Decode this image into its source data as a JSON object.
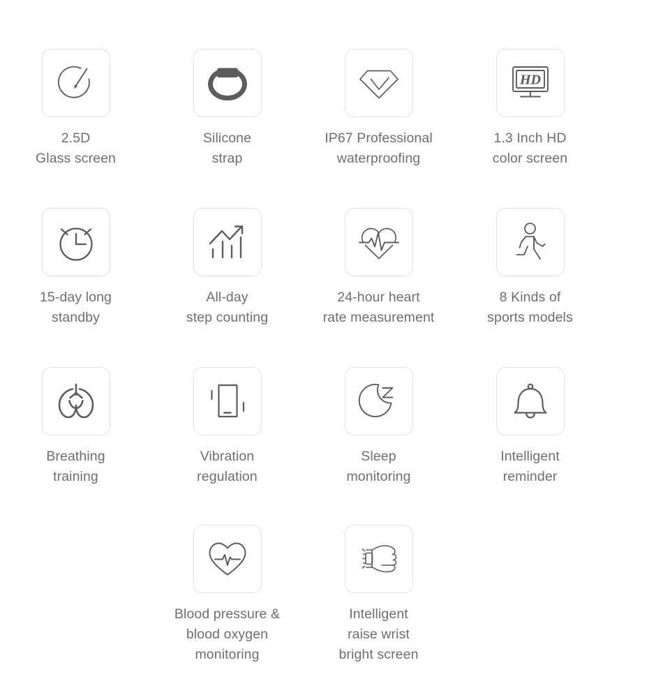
{
  "page": {
    "title": "Smart Band Feature Highlights",
    "background_color": "#ffffff",
    "icon_stroke_color": "#5c5c5c",
    "icon_box_border_color": "#e2e2e2",
    "text_color": "#6e6e6e"
  },
  "rows": [
    {
      "cells": [
        {
          "icon": "gauge-icon",
          "label": "2.5D\nGlass screen"
        },
        {
          "icon": "silicone-strap-icon",
          "label": "Silicone\nstrap"
        },
        {
          "icon": "diamond-waterproof-icon",
          "label": "IP67 Professional\nwaterproofing"
        },
        {
          "icon": "hd-monitor-icon",
          "label": "1.3 Inch HD\ncolor screen"
        }
      ]
    },
    {
      "cells": [
        {
          "icon": "alarm-clock-icon",
          "label": "15-day long\nstandby"
        },
        {
          "icon": "step-chart-icon",
          "label": "All-day\nstep counting"
        },
        {
          "icon": "heart-pulse-icon",
          "label": "24-hour heart\nrate measurement"
        },
        {
          "icon": "walking-person-icon",
          "label": "8 Kinds of\nsports models"
        }
      ]
    },
    {
      "cells": [
        {
          "icon": "lungs-icon",
          "label": "Breathing\ntraining"
        },
        {
          "icon": "vibration-phone-icon",
          "label": "Vibration\nregulation"
        },
        {
          "icon": "moon-sleep-icon",
          "label": "Sleep\nmonitoring"
        },
        {
          "icon": "bell-icon",
          "label": "Intelligent\nreminder"
        }
      ]
    },
    {
      "cells": [
        {
          "icon": "heart-ecg-icon",
          "label": "Blood pressure &\nblood oxygen\nmonitoring"
        },
        {
          "icon": "raise-wrist-icon",
          "label": "Intelligent\nraise wrist\nbright screen"
        }
      ]
    }
  ]
}
